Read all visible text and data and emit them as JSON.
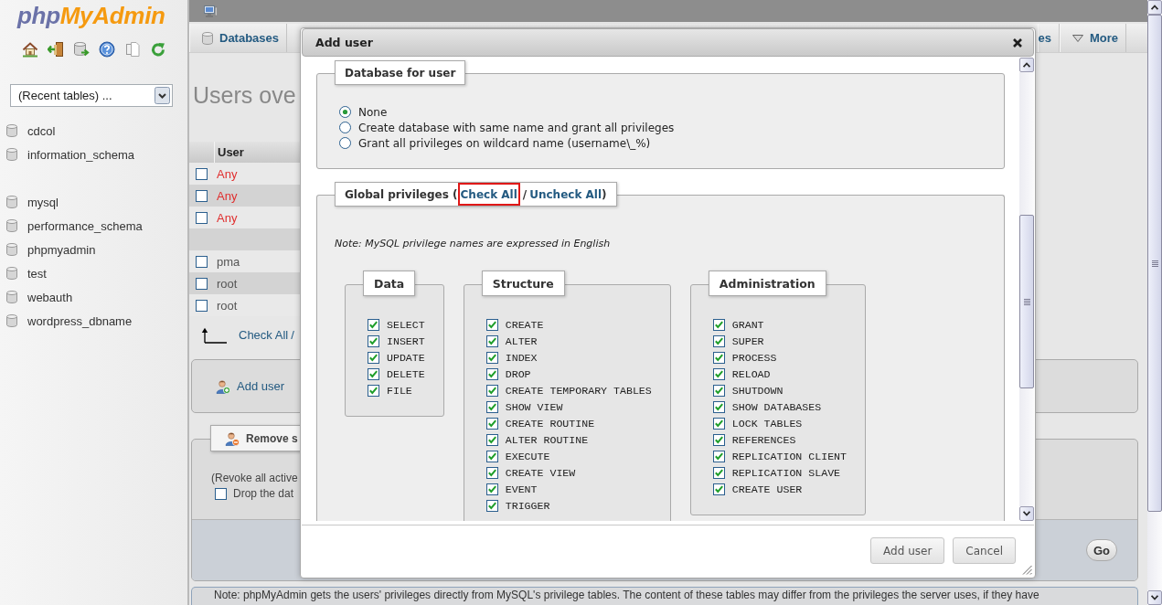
{
  "sidebar": {
    "logo": {
      "prefix": "php",
      "name": "MyAdmin"
    },
    "recent_tables": {
      "value": "(Recent tables) ..."
    },
    "database_groups": [
      {
        "databases": [
          "cdcol",
          "information_schema"
        ]
      },
      {
        "databases": [
          "mysql",
          "performance_schema",
          "phpmyadmin",
          "test",
          "webauth",
          "wordpress_dbname"
        ]
      }
    ]
  },
  "tabs": [
    {
      "label": "Databases",
      "kind": "database"
    },
    {
      "label": "es",
      "kind": "plain"
    },
    {
      "label": "More",
      "kind": "menu"
    }
  ],
  "users_page": {
    "heading": "Users ove",
    "table": {
      "columns": [
        "User"
      ],
      "rows": [
        {
          "kind": "anonymous",
          "user": "Any",
          "checked": false
        },
        {
          "kind": "anonymous",
          "user": "Any",
          "checked": false
        },
        {
          "kind": "anonymous",
          "user": "Any",
          "checked": false
        },
        {
          "kind": "blank"
        },
        {
          "kind": "named",
          "user": "pma",
          "checked": false
        },
        {
          "kind": "named",
          "user": "root",
          "checked": false
        },
        {
          "kind": "named",
          "user": "root",
          "checked": false
        }
      ]
    },
    "check_all": "Check All",
    "separator": "/",
    "add_user": "Add user",
    "remove_legend": "Remove s",
    "revoke_note": "(Revoke all active",
    "drop_option": {
      "label": "Drop the dat",
      "checked": false
    },
    "go_button": "Go",
    "footnote": "Note: phpMyAdmin gets the users' privileges directly from MySQL's privilege tables. The content of these tables may differ from the privileges the server uses, if they have"
  },
  "dialog": {
    "title": "Add user",
    "database_fieldset": {
      "legend": "Database for user",
      "options": [
        {
          "label": "None",
          "selected": true
        },
        {
          "label": "Create database with same name and grant all privileges",
          "selected": false
        },
        {
          "label": "Grant all privileges on wildcard name (username\\_%)",
          "selected": false
        }
      ]
    },
    "privileges_fieldset": {
      "legend_start": "Global privileges (",
      "check_all": {
        "label": "Check All",
        "highlighted": true
      },
      "separator": "/",
      "uncheck_all": "Uncheck All",
      "legend_end": ")",
      "note": "Note: MySQL privilege names are expressed in English",
      "groups": [
        {
          "title": "Data",
          "privileges": [
            {
              "name": "SELECT",
              "checked": true
            },
            {
              "name": "INSERT",
              "checked": true
            },
            {
              "name": "UPDATE",
              "checked": true
            },
            {
              "name": "DELETE",
              "checked": true
            },
            {
              "name": "FILE",
              "checked": true
            }
          ]
        },
        {
          "title": "Structure",
          "privileges": [
            {
              "name": "CREATE",
              "checked": true
            },
            {
              "name": "ALTER",
              "checked": true
            },
            {
              "name": "INDEX",
              "checked": true
            },
            {
              "name": "DROP",
              "checked": true
            },
            {
              "name": "CREATE TEMPORARY TABLES",
              "checked": true
            },
            {
              "name": "SHOW VIEW",
              "checked": true
            },
            {
              "name": "CREATE ROUTINE",
              "checked": true
            },
            {
              "name": "ALTER ROUTINE",
              "checked": true
            },
            {
              "name": "EXECUTE",
              "checked": true
            },
            {
              "name": "CREATE VIEW",
              "checked": true
            },
            {
              "name": "EVENT",
              "checked": true
            },
            {
              "name": "TRIGGER",
              "checked": true
            }
          ]
        },
        {
          "title": "Administration",
          "privileges": [
            {
              "name": "GRANT",
              "checked": true
            },
            {
              "name": "SUPER",
              "checked": true
            },
            {
              "name": "PROCESS",
              "checked": true
            },
            {
              "name": "RELOAD",
              "checked": true
            },
            {
              "name": "SHUTDOWN",
              "checked": true
            },
            {
              "name": "SHOW DATABASES",
              "checked": true
            },
            {
              "name": "LOCK TABLES",
              "checked": true
            },
            {
              "name": "REFERENCES",
              "checked": true
            },
            {
              "name": "REPLICATION CLIENT",
              "checked": true
            },
            {
              "name": "REPLICATION SLAVE",
              "checked": true
            },
            {
              "name": "CREATE USER",
              "checked": true
            }
          ]
        }
      ]
    },
    "buttons": [
      {
        "label": "Add user"
      },
      {
        "label": "Cancel"
      }
    ]
  }
}
